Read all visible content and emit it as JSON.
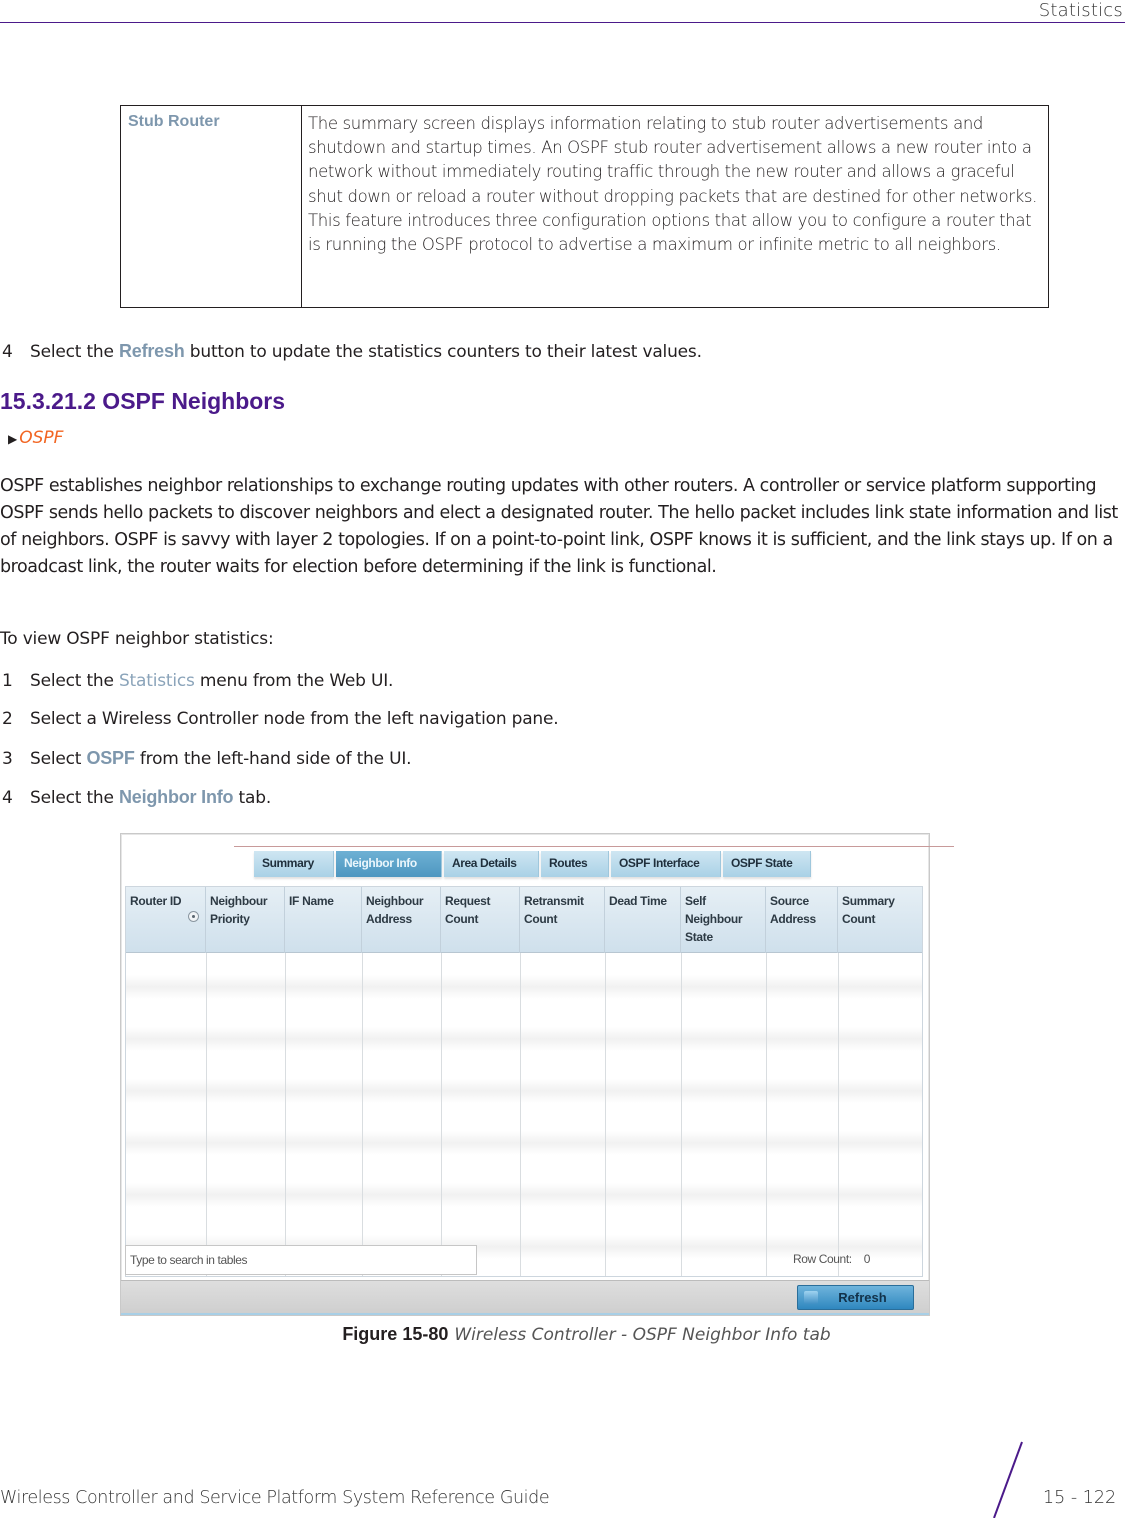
{
  "header": {
    "section_title": "Statistics"
  },
  "definition_table": {
    "term": "Stub Router",
    "description": "The summary screen displays information relating to stub router advertisements and shutdown and startup times. An OSPF stub router advertisement allows a new router into a network without immediately routing traffic through the new router and allows a graceful shut down or reload a router without dropping packets that are destined for other networks. This feature introduces three configuration options that allow you to configure a router that is running the OSPF protocol to advertise a maximum or infinite metric to all neighbors."
  },
  "step_refresh": {
    "number": "4",
    "prefix": "Select the ",
    "keyword": "Refresh",
    "suffix": " button to update the statistics counters to their latest values."
  },
  "section": {
    "heading": "15.3.21.2  OSPF Neighbors",
    "xref": "OSPF",
    "intro": "OSPF establishes neighbor relationships to exchange routing updates with other routers. A controller or service platform supporting OSPF sends hello packets to discover neighbors and elect a designated router. The hello packet includes link state information and list of neighbors. OSPF is savvy with layer 2 topologies. If on a point-to-point link, OSPF knows it is sufficient, and the link stays up. If on a broadcast link, the router waits for election before determining if the link is functional.",
    "procedure_intro": "To view OSPF neighbor statistics:",
    "steps": [
      {
        "number": "1",
        "prefix": "Select the ",
        "keyword": "Statistics",
        "suffix": " menu from the Web UI."
      },
      {
        "number": "2",
        "prefix": "Select a Wireless Controller node from the left navigation pane.",
        "keyword": "",
        "suffix": ""
      },
      {
        "number": "3",
        "prefix": "Select ",
        "keyword": "OSPF",
        "suffix": " from the left-hand side of the UI."
      },
      {
        "number": "4",
        "prefix": "Select the ",
        "keyword": "Neighbor Info",
        "suffix": " tab."
      }
    ]
  },
  "figure": {
    "tabs": [
      {
        "label": "Summary",
        "active": false
      },
      {
        "label": "Neighbor Info",
        "active": true
      },
      {
        "label": "Area Details",
        "active": false
      },
      {
        "label": "Routes",
        "active": false
      },
      {
        "label": "OSPF Interface",
        "active": false
      },
      {
        "label": "OSPF State",
        "active": false
      }
    ],
    "columns": [
      "Router ID",
      "Neighbour Priority",
      "IF Name",
      "Neighbour Address",
      "Request Count",
      "Retransmit Count",
      "Dead Time",
      "Self Neighbour State",
      "Source Address",
      "Summary Count"
    ],
    "rows": [],
    "search_placeholder": "Type to search in tables",
    "row_count_label": "Row Count:",
    "row_count_value": "0",
    "refresh_label": "Refresh",
    "colors": {
      "tab_active": "#4e97c0",
      "tab_inactive": "#a9d1e6",
      "refresh_button": "#2f87bf"
    }
  },
  "caption": {
    "number": "Figure 15-80",
    "title": "Wireless Controller - OSPF Neighbor Info tab"
  },
  "footer": {
    "guide_title": "Wireless Controller and Service Platform System Reference Guide",
    "page_number": "15 - 122"
  },
  "colors": {
    "heading": "#4b1a8a",
    "keyword": "#7e97ad",
    "xref": "#f26522"
  }
}
